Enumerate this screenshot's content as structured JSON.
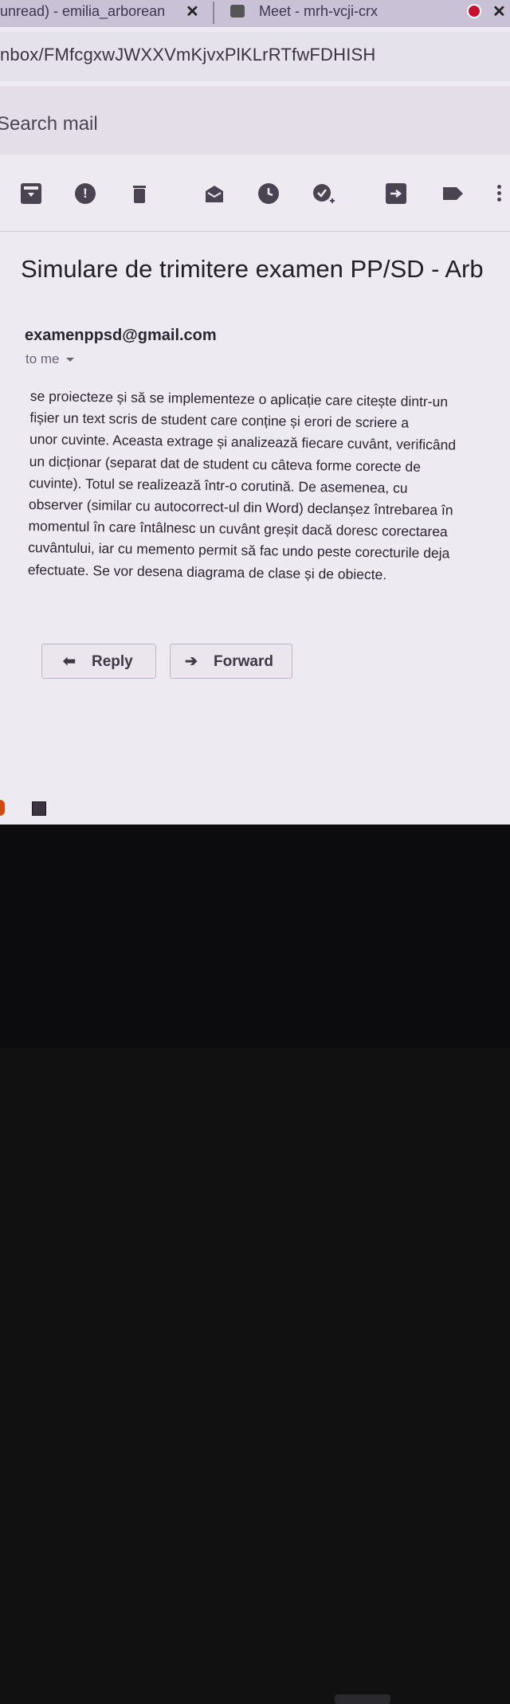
{
  "browser": {
    "tabs": [
      {
        "title": "unread) - emilia_arborean",
        "close": "✕"
      },
      {
        "title": "Meet - mrh-vcji-crx"
      }
    ],
    "url": "nbox/FMfcgxwJWXXVmKjvxPlKLrRTfwFDHISH"
  },
  "search": {
    "placeholder": "Search mail"
  },
  "toolbar_icons": [
    "archive-icon",
    "report-spam-icon",
    "delete-icon",
    "mark-unread-icon",
    "snooze-icon",
    "add-task-icon",
    "move-to-icon",
    "label-icon",
    "more-icon"
  ],
  "email": {
    "subject": "Simulare de trimitere examen PP/SD - Arb",
    "sender": "examenppsd@gmail.com",
    "recipient": "to me",
    "body_lines": [
      "se proiecteze și să se implementeze o aplicație care citește dintr-un",
      "fișier un text scris de student care conține și erori de scriere a",
      "unor cuvinte. Aceasta extrage și analizează fiecare cuvânt, verificând",
      "un dicționar (separat dat de student cu câteva forme corecte de",
      "cuvinte). Totul se realizează într-o corutină. De asemenea, cu",
      "observer (similar cu autocorrect-ul din Word) declanșez întrebarea în",
      "momentul în care întâlnesc un cuvânt greșit dacă doresc corectarea",
      "cuvântului, iar cu memento permit să fac undo peste corecturile deja",
      "efectuate. Se vor desena diagrama de clase și de obiecte."
    ]
  },
  "actions": {
    "reply": "Reply",
    "forward": "Forward"
  },
  "colors": {
    "record": "#c8102e",
    "tabbar": "#c9c2d6"
  }
}
